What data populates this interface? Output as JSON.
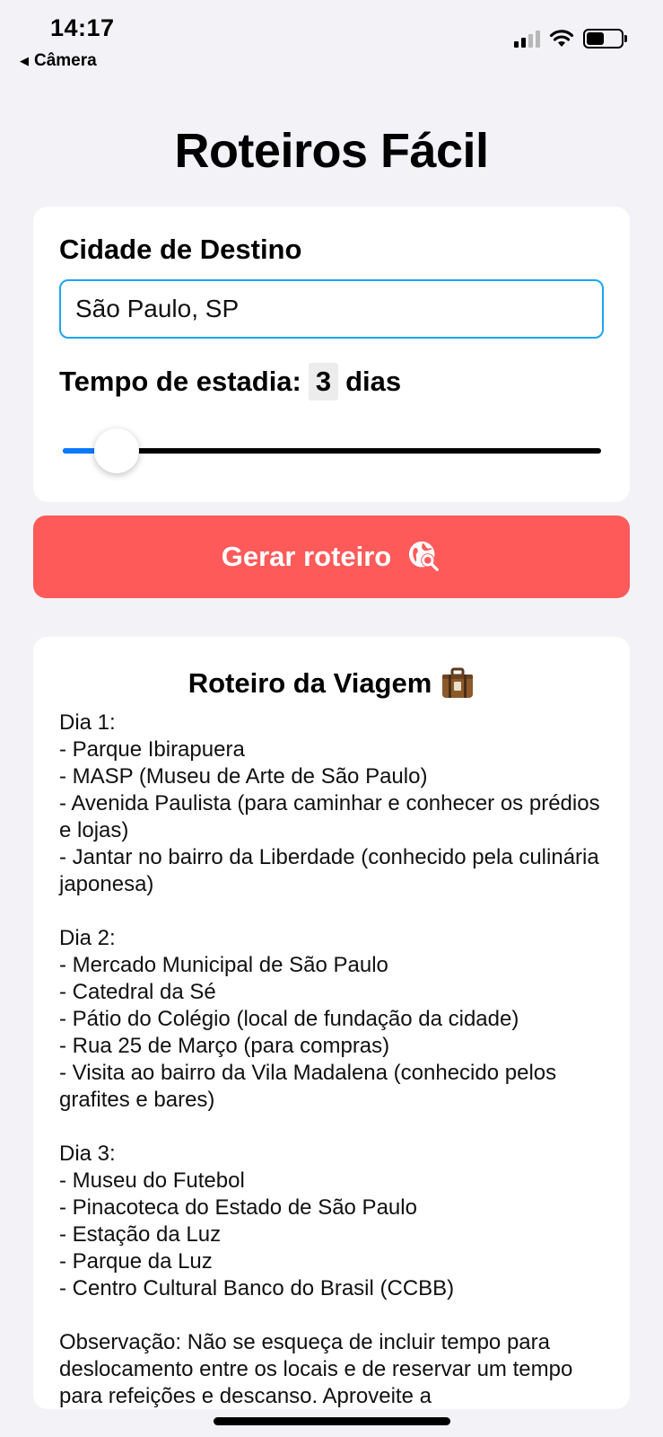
{
  "status_bar": {
    "time": "14:17",
    "back_label": "Câmera",
    "back_icon": "back-triangle-icon",
    "signal_icon": "cellular-signal-icon",
    "wifi_icon": "wifi-icon",
    "battery_icon": "battery-icon",
    "battery_level": 0.5
  },
  "app": {
    "title": "Roteiros Fácil"
  },
  "form": {
    "city_label": "Cidade de Destino",
    "city_value": "São Paulo, SP",
    "stay_label": "Tempo de estadia:",
    "stay_value": "3",
    "stay_unit": "dias",
    "slider_fraction": 0.1,
    "slider_accent": "#0a7aff"
  },
  "button": {
    "label": "Gerar roteiro",
    "icon": "globe-search-icon",
    "color": "#ff5a5a"
  },
  "result": {
    "title": "Roteiro da Viagem",
    "title_icon": "suitcase-icon",
    "text": "Dia 1:\n- Parque Ibirapuera\n- MASP (Museu de Arte de São Paulo)\n- Avenida Paulista (para caminhar e conhecer os prédios e lojas)\n- Jantar no bairro da Liberdade (conhecido pela culinária japonesa)\n\nDia 2:\n- Mercado Municipal de São Paulo\n- Catedral da Sé\n- Pátio do Colégio (local de fundação da cidade)\n- Rua 25 de Março (para compras)\n- Visita ao bairro da Vila Madalena (conhecido pelos grafites e bares)\n\nDia 3:\n- Museu do Futebol\n- Pinacoteca do Estado de São Paulo\n- Estação da Luz\n- Parque da Luz\n- Centro Cultural Banco do Brasil (CCBB)\n\nObservação: Não se esqueça de incluir tempo para deslocamento entre os locais e de reservar um tempo para refeições e descanso. Aproveite a"
  }
}
